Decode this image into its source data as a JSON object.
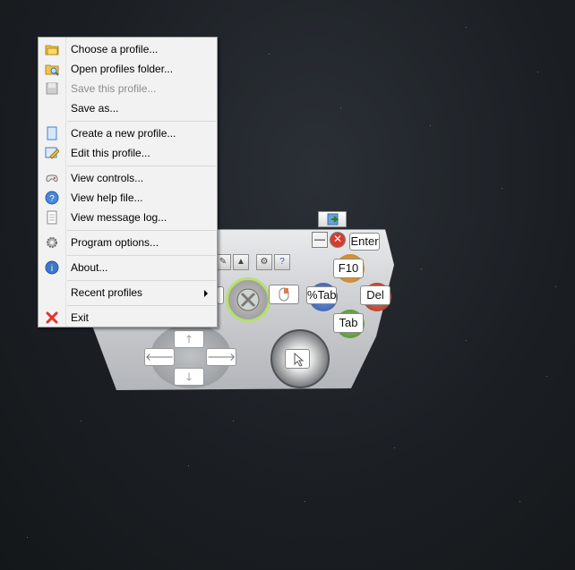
{
  "menu": {
    "items": [
      {
        "label": "Choose a profile...",
        "icon": "folder-open-icon",
        "disabled": false
      },
      {
        "label": "Open profiles folder...",
        "icon": "folder-search-icon",
        "disabled": false
      },
      {
        "label": "Save this profile...",
        "icon": "save-icon",
        "disabled": true
      },
      {
        "label": "Save as...",
        "icon": "",
        "disabled": false
      },
      {
        "label": "Create a new profile...",
        "icon": "new-document-icon",
        "disabled": false
      },
      {
        "label": "Edit this profile...",
        "icon": "edit-icon",
        "disabled": false
      },
      {
        "label": "View controls...",
        "icon": "gamepad-icon",
        "disabled": false
      },
      {
        "label": "View help file...",
        "icon": "help-icon",
        "disabled": false
      },
      {
        "label": "View message log...",
        "icon": "document-icon",
        "disabled": false
      },
      {
        "label": "Program options...",
        "icon": "gear-icon",
        "disabled": false
      },
      {
        "label": "About...",
        "icon": "info-icon",
        "disabled": false
      },
      {
        "label": "Recent profiles",
        "icon": "",
        "disabled": false,
        "submenu": true
      },
      {
        "label": "Exit",
        "icon": "close-red-icon",
        "disabled": false
      }
    ]
  },
  "controller": {
    "keys": {
      "enter": "Enter",
      "f10": "F10",
      "del": "Del",
      "tab": "Tab",
      "pct_tab": "%Tab"
    },
    "button_colors": {
      "y": "#d08a24",
      "b": "#c2432e",
      "x": "#3a65b8",
      "a": "#5d9b3a"
    }
  }
}
